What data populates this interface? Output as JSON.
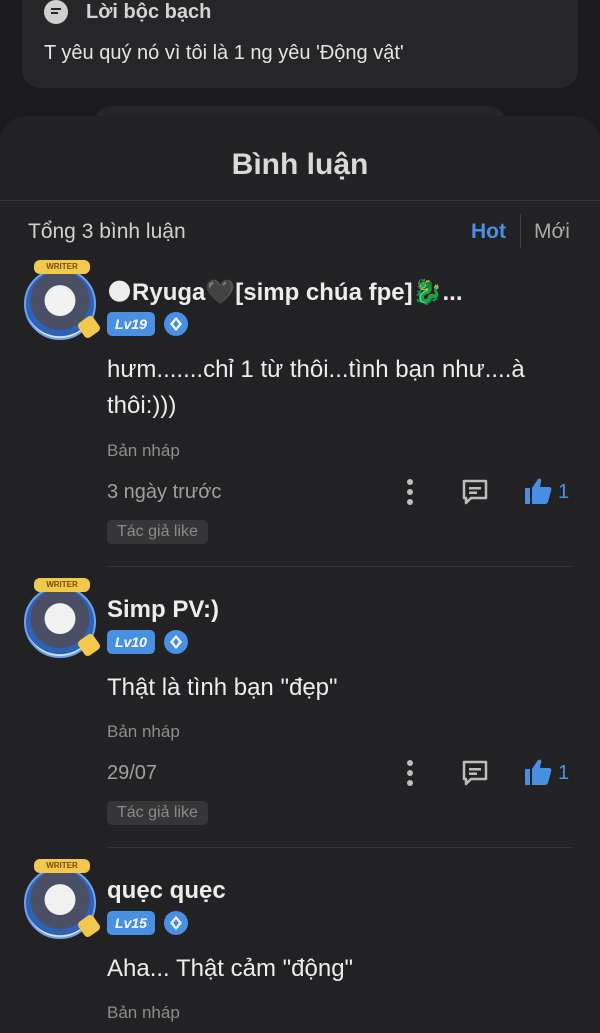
{
  "top_card": {
    "title": "Lời bộc bạch",
    "body": "T yêu quý nó vì tôi là 1 ng yêu 'Động vật'"
  },
  "comments_panel": {
    "title": "Bình luận",
    "total": "Tổng 3 bình luận",
    "sort": {
      "hot": "Hot",
      "new": "Mới"
    }
  },
  "comments": [
    {
      "username": "🌑Ryuga🖤[simp chúa fpe]🐉...",
      "level": "Lv19",
      "avatar_badge": "WRITER",
      "text": "hưm.......chỉ 1 từ thôi...tình bạn như....à thôi:)))",
      "draft": "Bản nháp",
      "time": "3 ngày trước",
      "likes": "1",
      "author_like": "Tác giả like"
    },
    {
      "username": "Simp PV:)",
      "level": "Lv10",
      "avatar_badge": "WRITER",
      "text": "Thật là tình bạn \"đẹp\"",
      "draft": "Bản nháp",
      "time": "29/07",
      "likes": "1",
      "author_like": "Tác giả like"
    },
    {
      "username": "quẹc quẹc",
      "level": "Lv15",
      "avatar_badge": "WRITER",
      "text": "Aha... Thật cảm \"động\"",
      "draft": "Bản nháp"
    }
  ],
  "colors": {
    "accent": "#4a90e2",
    "background": "#1b1b1d",
    "panel": "#222224"
  }
}
